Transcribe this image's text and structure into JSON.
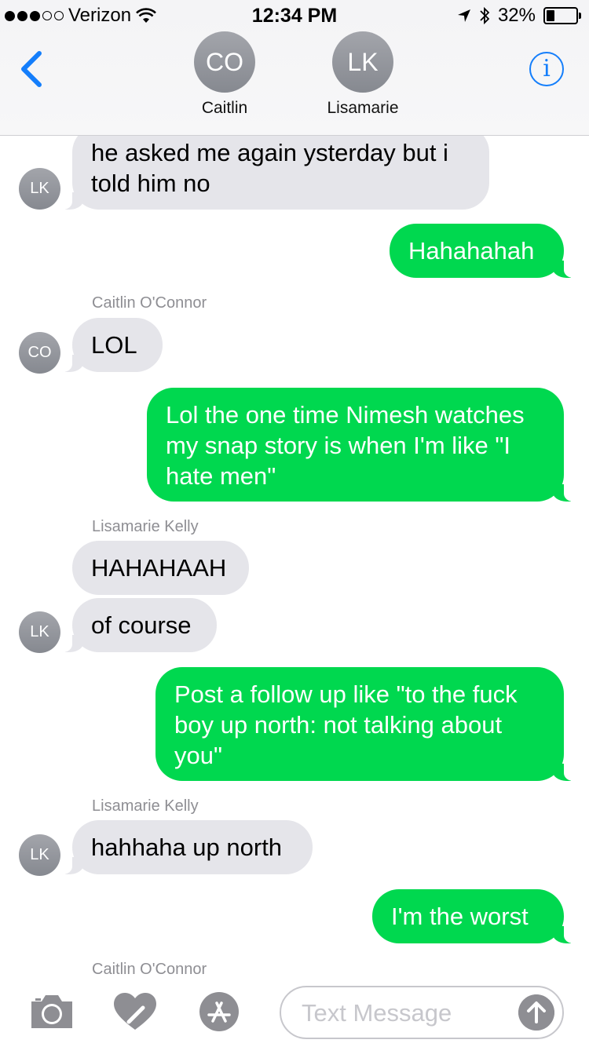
{
  "status_bar": {
    "carrier": "Verizon",
    "time": "12:34 PM",
    "battery": "32%",
    "battery_level": 0.32
  },
  "header": {
    "contacts": [
      {
        "initials": "CO",
        "name": "Caitlin"
      },
      {
        "initials": "LK",
        "name": "Lisamarie"
      }
    ]
  },
  "messages": [
    {
      "direction": "in",
      "avatar": "LK",
      "text_lines": [
        "he asked me again ysterday but i",
        "told him no"
      ]
    },
    {
      "direction": "out",
      "text_lines": [
        "Hahahahah"
      ]
    },
    {
      "sender": "Caitlin O'Connor"
    },
    {
      "direction": "in",
      "avatar": "CO",
      "text_lines": [
        "LOL"
      ]
    },
    {
      "direction": "out",
      "text_lines": [
        "Lol the one time Nimesh watches",
        "my snap story is when I'm like \"I",
        "hate men\""
      ]
    },
    {
      "sender": "Lisamarie Kelly"
    },
    {
      "direction": "in",
      "text_lines": [
        "HAHAHAAH"
      ]
    },
    {
      "direction": "in",
      "avatar": "LK",
      "text_lines": [
        "of course"
      ]
    },
    {
      "direction": "out",
      "text_lines": [
        "Post a follow up like \"to the fuck",
        "boy up north: not talking about",
        "you\""
      ]
    },
    {
      "sender": "Lisamarie Kelly"
    },
    {
      "direction": "in",
      "avatar": "LK",
      "text_lines": [
        "hahhaha up north"
      ]
    },
    {
      "direction": "out",
      "text_lines": [
        "I'm the worst"
      ]
    },
    {
      "sender": "Caitlin O'Connor"
    }
  ],
  "compose": {
    "placeholder": "Text Message"
  },
  "colors": {
    "outgoing_bubble": "#00d84f",
    "incoming_bubble": "#e5e5ea",
    "accent": "#147efb"
  },
  "icons": [
    "wifi-icon",
    "location-arrow-icon",
    "bluetooth-icon",
    "battery-icon",
    "back-chevron-icon",
    "info-icon",
    "camera-icon",
    "digital-touch-icon",
    "app-store-icon",
    "send-arrow-icon"
  ]
}
